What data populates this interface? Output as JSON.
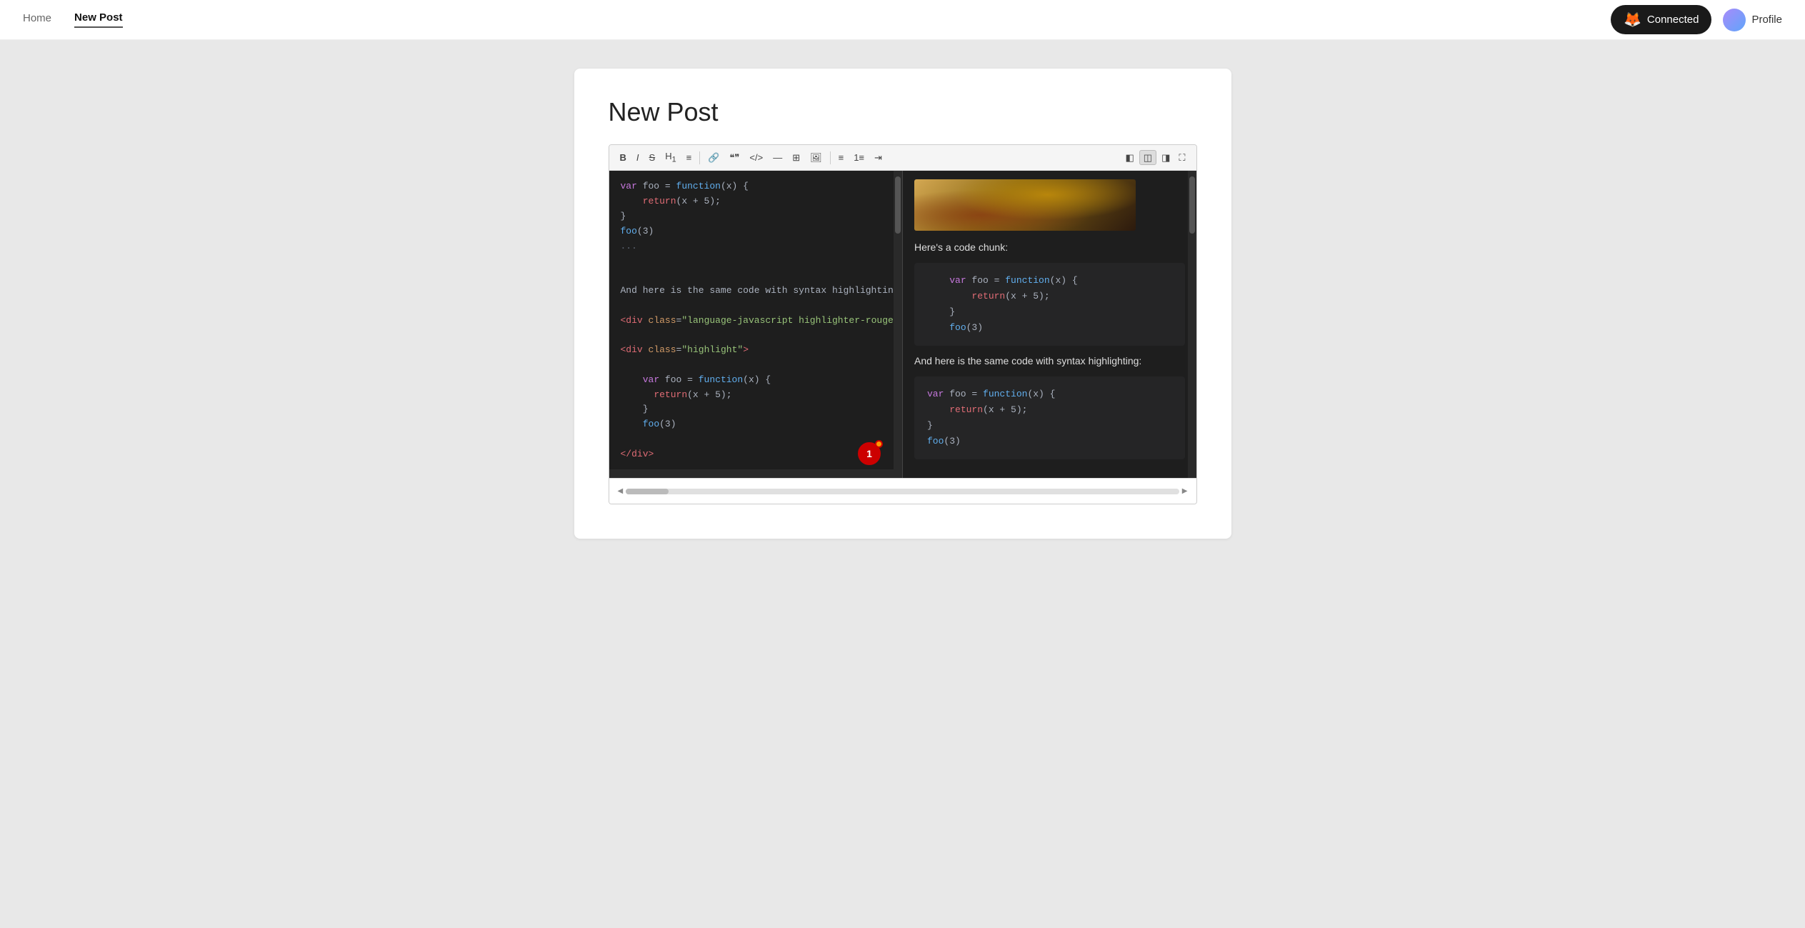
{
  "nav": {
    "home_label": "Home",
    "new_post_label": "New Post",
    "connected_label": "Connected",
    "profile_label": "Profile"
  },
  "page": {
    "title": "New Post"
  },
  "toolbar": {
    "buttons": [
      {
        "id": "bold",
        "symbol": "B",
        "title": "Bold"
      },
      {
        "id": "italic",
        "symbol": "I",
        "title": "Italic"
      },
      {
        "id": "strikethrough",
        "symbol": "S̶",
        "title": "Strikethrough"
      },
      {
        "id": "heading",
        "symbol": "H₁",
        "title": "Heading"
      },
      {
        "id": "blockquote",
        "symbol": "❝",
        "title": "Blockquote"
      },
      {
        "id": "link",
        "symbol": "🔗",
        "title": "Link"
      },
      {
        "id": "quote",
        "symbol": "\"\"",
        "title": "Quote"
      },
      {
        "id": "code-inline",
        "symbol": "</>",
        "title": "Inline Code"
      },
      {
        "id": "horizontal",
        "symbol": "—",
        "title": "Horizontal Rule"
      },
      {
        "id": "table",
        "symbol": "⊞",
        "title": "Table"
      },
      {
        "id": "image",
        "symbol": "🖼",
        "title": "Image"
      },
      {
        "id": "ul",
        "symbol": "≡",
        "title": "Unordered List"
      },
      {
        "id": "ol",
        "symbol": "1.",
        "title": "Ordered List"
      },
      {
        "id": "indent",
        "symbol": "⇥",
        "title": "Indent"
      }
    ],
    "right_buttons": [
      {
        "id": "split-left",
        "symbol": "◧",
        "title": "Editor Only"
      },
      {
        "id": "split-both",
        "symbol": "◫",
        "title": "Split View"
      },
      {
        "id": "split-right",
        "symbol": "◨",
        "title": "Preview Only"
      },
      {
        "id": "fullscreen",
        "symbol": "⛶",
        "title": "Fullscreen"
      }
    ]
  },
  "editor": {
    "code_lines": [
      "var foo = function(x) {",
      "    return(x + 5);",
      "}",
      "foo(3)",
      "...",
      "",
      "",
      "And here is the same code with syntax highlighting:",
      "",
      "<div class=\"language-javascript highlighter-rouge\">",
      "",
      "<div class=\"highlight\">",
      "",
      "    var foo = function(x) {",
      "      return(x + 5);",
      "    }",
      "    foo(3)",
      "",
      "</div>",
      "",
      "</div>"
    ]
  },
  "preview": {
    "code_chunk_label": "Here's a code chunk:",
    "code_block_lines": [
      "    var foo = function(x) {",
      "        return(x + 5);",
      "    }",
      "    foo(3)"
    ],
    "highlight_label": "And here is the same code with syntax highlighting:",
    "highlight_lines": [
      "var foo = function(x) {",
      "    return(x + 5);",
      "}",
      "foo(3)"
    ]
  },
  "notification": {
    "count": "1"
  }
}
